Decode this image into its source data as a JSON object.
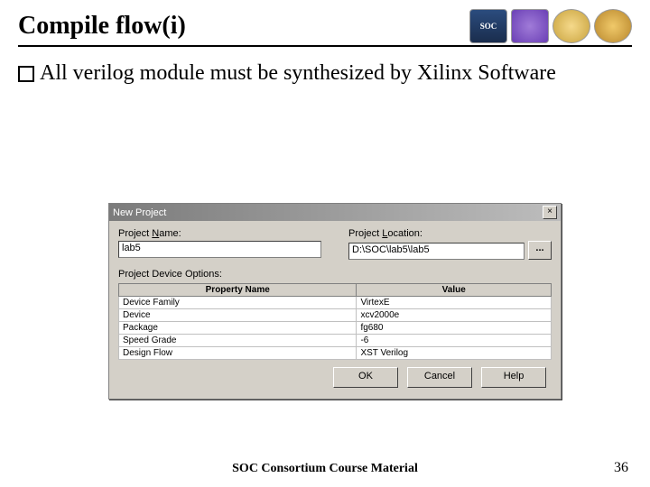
{
  "slide": {
    "title": "Compile flow(i)",
    "bullet": "All verilog module must be synthesized by Xilinx Software",
    "footer": "SOC Consortium Course Material",
    "page_number": "36"
  },
  "logos": {
    "soc": "SOC",
    "purple": "",
    "gold1": "",
    "gold2": ""
  },
  "dialog": {
    "title": "New Project",
    "close": "×",
    "name_label_pre": "Project ",
    "name_label_u": "N",
    "name_label_post": "ame:",
    "name_value": "lab5",
    "loc_label_pre": "Project ",
    "loc_label_u": "L",
    "loc_label_post": "ocation:",
    "loc_value": "D:\\SOC\\lab5\\lab5",
    "browse": "...",
    "options_label": "Project Device Options:",
    "col_property": "Property Name",
    "col_value": "Value",
    "rows": [
      {
        "prop": "Device Family",
        "val": "VirtexE"
      },
      {
        "prop": "Device",
        "val": "xcv2000e"
      },
      {
        "prop": "Package",
        "val": "fg680"
      },
      {
        "prop": "Speed Grade",
        "val": "-6"
      },
      {
        "prop": "Design Flow",
        "val": "XST Verilog"
      }
    ],
    "ok": "OK",
    "cancel": "Cancel",
    "help": "Help"
  }
}
